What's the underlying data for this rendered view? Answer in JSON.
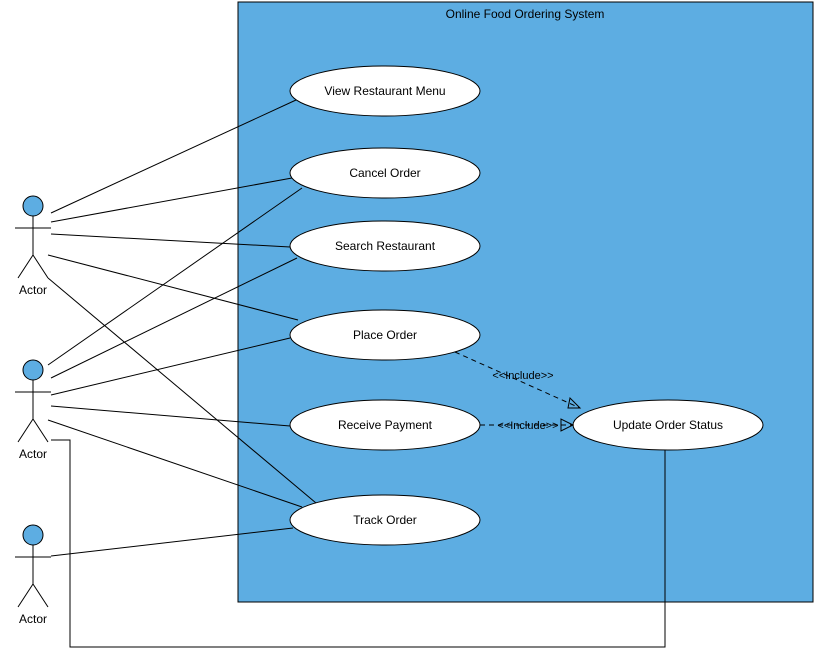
{
  "system": {
    "title": "Online Food Ordering System"
  },
  "actors": [
    {
      "label": "Actor"
    },
    {
      "label": "Actor"
    },
    {
      "label": "Actor"
    }
  ],
  "usecases": {
    "viewMenu": "View Restaurant Menu",
    "cancelOrder": "Cancel Order",
    "searchRestaurant": "Search Restaurant",
    "placeOrder": "Place Order",
    "receivePayment": "Receive Payment",
    "updateStatus": "Update Order Status",
    "trackOrder": "Track Order"
  },
  "includes": {
    "label1": "<<Include>>",
    "label2": "<<Include>>"
  }
}
